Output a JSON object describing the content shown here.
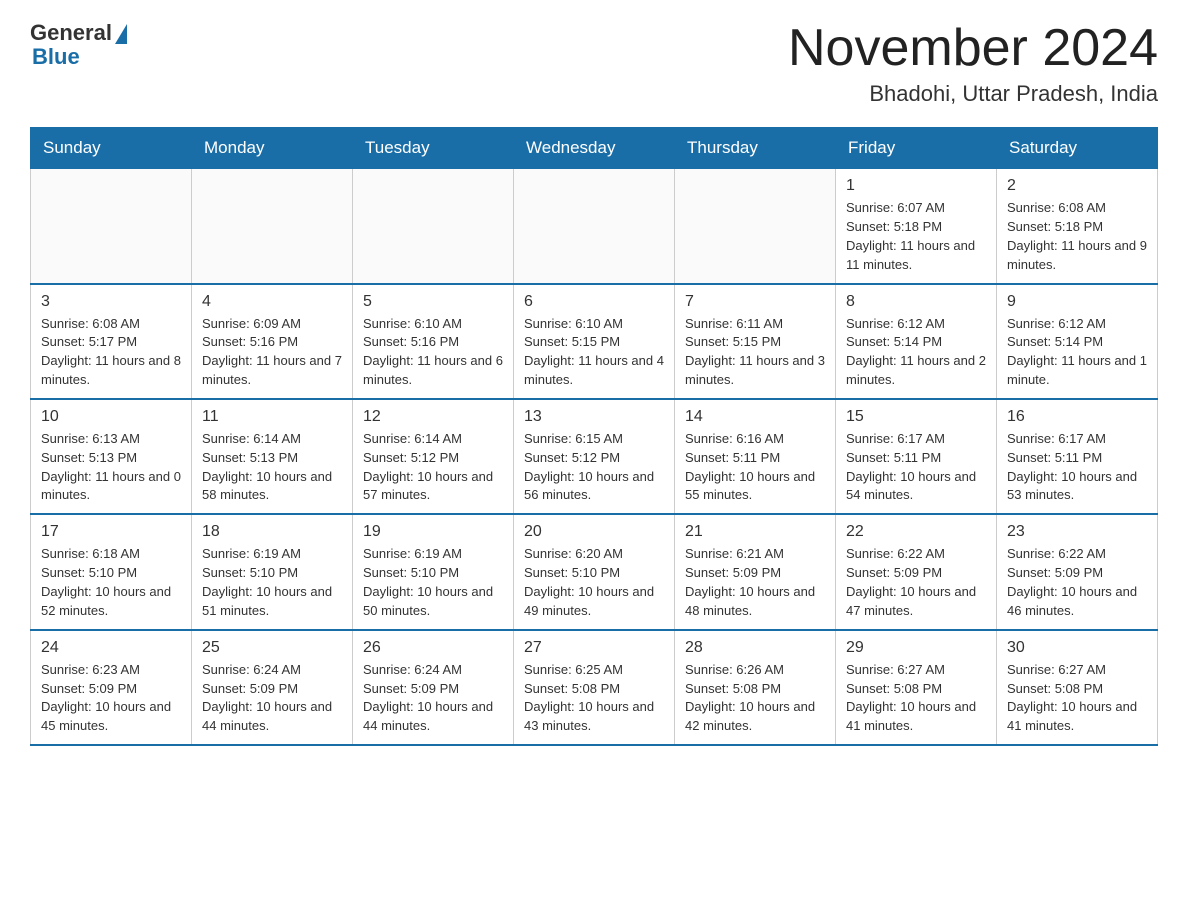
{
  "header": {
    "logo": {
      "general": "General",
      "blue": "Blue"
    },
    "title": "November 2024",
    "location": "Bhadohi, Uttar Pradesh, India"
  },
  "days_of_week": [
    "Sunday",
    "Monday",
    "Tuesday",
    "Wednesday",
    "Thursday",
    "Friday",
    "Saturday"
  ],
  "weeks": [
    [
      {
        "day": "",
        "info": ""
      },
      {
        "day": "",
        "info": ""
      },
      {
        "day": "",
        "info": ""
      },
      {
        "day": "",
        "info": ""
      },
      {
        "day": "",
        "info": ""
      },
      {
        "day": "1",
        "info": "Sunrise: 6:07 AM\nSunset: 5:18 PM\nDaylight: 11 hours and 11 minutes."
      },
      {
        "day": "2",
        "info": "Sunrise: 6:08 AM\nSunset: 5:18 PM\nDaylight: 11 hours and 9 minutes."
      }
    ],
    [
      {
        "day": "3",
        "info": "Sunrise: 6:08 AM\nSunset: 5:17 PM\nDaylight: 11 hours and 8 minutes."
      },
      {
        "day": "4",
        "info": "Sunrise: 6:09 AM\nSunset: 5:16 PM\nDaylight: 11 hours and 7 minutes."
      },
      {
        "day": "5",
        "info": "Sunrise: 6:10 AM\nSunset: 5:16 PM\nDaylight: 11 hours and 6 minutes."
      },
      {
        "day": "6",
        "info": "Sunrise: 6:10 AM\nSunset: 5:15 PM\nDaylight: 11 hours and 4 minutes."
      },
      {
        "day": "7",
        "info": "Sunrise: 6:11 AM\nSunset: 5:15 PM\nDaylight: 11 hours and 3 minutes."
      },
      {
        "day": "8",
        "info": "Sunrise: 6:12 AM\nSunset: 5:14 PM\nDaylight: 11 hours and 2 minutes."
      },
      {
        "day": "9",
        "info": "Sunrise: 6:12 AM\nSunset: 5:14 PM\nDaylight: 11 hours and 1 minute."
      }
    ],
    [
      {
        "day": "10",
        "info": "Sunrise: 6:13 AM\nSunset: 5:13 PM\nDaylight: 11 hours and 0 minutes."
      },
      {
        "day": "11",
        "info": "Sunrise: 6:14 AM\nSunset: 5:13 PM\nDaylight: 10 hours and 58 minutes."
      },
      {
        "day": "12",
        "info": "Sunrise: 6:14 AM\nSunset: 5:12 PM\nDaylight: 10 hours and 57 minutes."
      },
      {
        "day": "13",
        "info": "Sunrise: 6:15 AM\nSunset: 5:12 PM\nDaylight: 10 hours and 56 minutes."
      },
      {
        "day": "14",
        "info": "Sunrise: 6:16 AM\nSunset: 5:11 PM\nDaylight: 10 hours and 55 minutes."
      },
      {
        "day": "15",
        "info": "Sunrise: 6:17 AM\nSunset: 5:11 PM\nDaylight: 10 hours and 54 minutes."
      },
      {
        "day": "16",
        "info": "Sunrise: 6:17 AM\nSunset: 5:11 PM\nDaylight: 10 hours and 53 minutes."
      }
    ],
    [
      {
        "day": "17",
        "info": "Sunrise: 6:18 AM\nSunset: 5:10 PM\nDaylight: 10 hours and 52 minutes."
      },
      {
        "day": "18",
        "info": "Sunrise: 6:19 AM\nSunset: 5:10 PM\nDaylight: 10 hours and 51 minutes."
      },
      {
        "day": "19",
        "info": "Sunrise: 6:19 AM\nSunset: 5:10 PM\nDaylight: 10 hours and 50 minutes."
      },
      {
        "day": "20",
        "info": "Sunrise: 6:20 AM\nSunset: 5:10 PM\nDaylight: 10 hours and 49 minutes."
      },
      {
        "day": "21",
        "info": "Sunrise: 6:21 AM\nSunset: 5:09 PM\nDaylight: 10 hours and 48 minutes."
      },
      {
        "day": "22",
        "info": "Sunrise: 6:22 AM\nSunset: 5:09 PM\nDaylight: 10 hours and 47 minutes."
      },
      {
        "day": "23",
        "info": "Sunrise: 6:22 AM\nSunset: 5:09 PM\nDaylight: 10 hours and 46 minutes."
      }
    ],
    [
      {
        "day": "24",
        "info": "Sunrise: 6:23 AM\nSunset: 5:09 PM\nDaylight: 10 hours and 45 minutes."
      },
      {
        "day": "25",
        "info": "Sunrise: 6:24 AM\nSunset: 5:09 PM\nDaylight: 10 hours and 44 minutes."
      },
      {
        "day": "26",
        "info": "Sunrise: 6:24 AM\nSunset: 5:09 PM\nDaylight: 10 hours and 44 minutes."
      },
      {
        "day": "27",
        "info": "Sunrise: 6:25 AM\nSunset: 5:08 PM\nDaylight: 10 hours and 43 minutes."
      },
      {
        "day": "28",
        "info": "Sunrise: 6:26 AM\nSunset: 5:08 PM\nDaylight: 10 hours and 42 minutes."
      },
      {
        "day": "29",
        "info": "Sunrise: 6:27 AM\nSunset: 5:08 PM\nDaylight: 10 hours and 41 minutes."
      },
      {
        "day": "30",
        "info": "Sunrise: 6:27 AM\nSunset: 5:08 PM\nDaylight: 10 hours and 41 minutes."
      }
    ]
  ]
}
